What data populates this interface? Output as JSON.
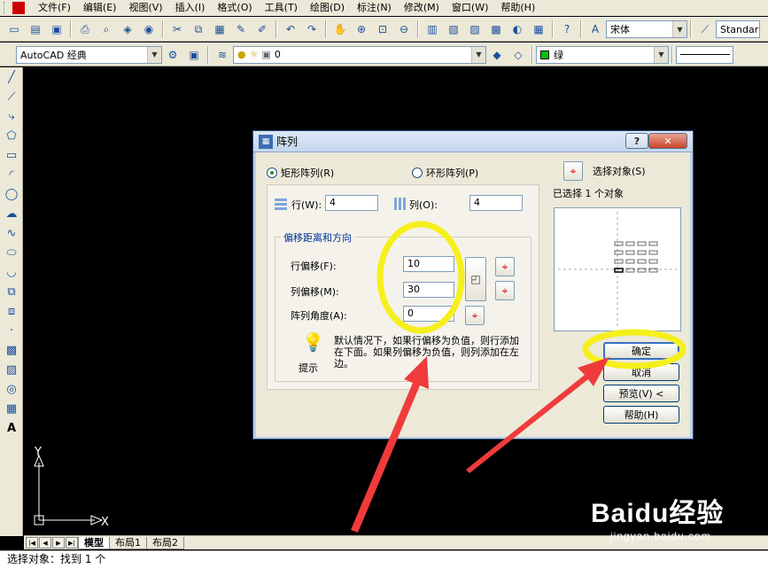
{
  "menu": [
    "文件(F)",
    "编辑(E)",
    "视图(V)",
    "插入(I)",
    "格式(O)",
    "工具(T)",
    "绘图(D)",
    "标注(N)",
    "修改(M)",
    "窗口(W)",
    "帮助(H)"
  ],
  "toolbar": {
    "font_combo": "宋体",
    "style_combo": "Standar",
    "workspace_combo": "AutoCAD 经典",
    "layer_combo": "0",
    "color_combo": "绿"
  },
  "tabs": [
    "模型",
    "布局1",
    "布局2"
  ],
  "command_line": "选择对象：找到 1 个",
  "ucs": {
    "x": "X",
    "y": "Y"
  },
  "dialog": {
    "title": "阵列",
    "help": "?",
    "close": "✕",
    "rect_array": "矩形阵列(R)",
    "polar_array": "环形阵列(P)",
    "rows_label": "行(W):",
    "rows_value": "4",
    "cols_label": "列(O):",
    "cols_value": "4",
    "offset_group": "偏移距离和方向",
    "row_offset_label": "行偏移(F):",
    "row_offset_value": "10",
    "col_offset_label": "列偏移(M):",
    "col_offset_value": "30",
    "angle_label": "阵列角度(A):",
    "angle_value": "0",
    "tip_label": "提示",
    "tip_text": "默认情况下，如果行偏移为负值，则行添加在下面。如果列偏移为负值，则列添加在左边。",
    "select_objects": "选择对象(S)",
    "selected_count": "已选择 1 个对象",
    "ok": "确定",
    "cancel": "取消",
    "preview": "预览(V) <",
    "help_btn": "帮助(H)"
  },
  "watermark": {
    "brand": "Baidu经验",
    "url": "jingyan.baidu.com"
  },
  "colors": {
    "annotation": "#f5ef1c",
    "arrow": "#ef3b3b",
    "titlebar": "#c5d7ee"
  }
}
